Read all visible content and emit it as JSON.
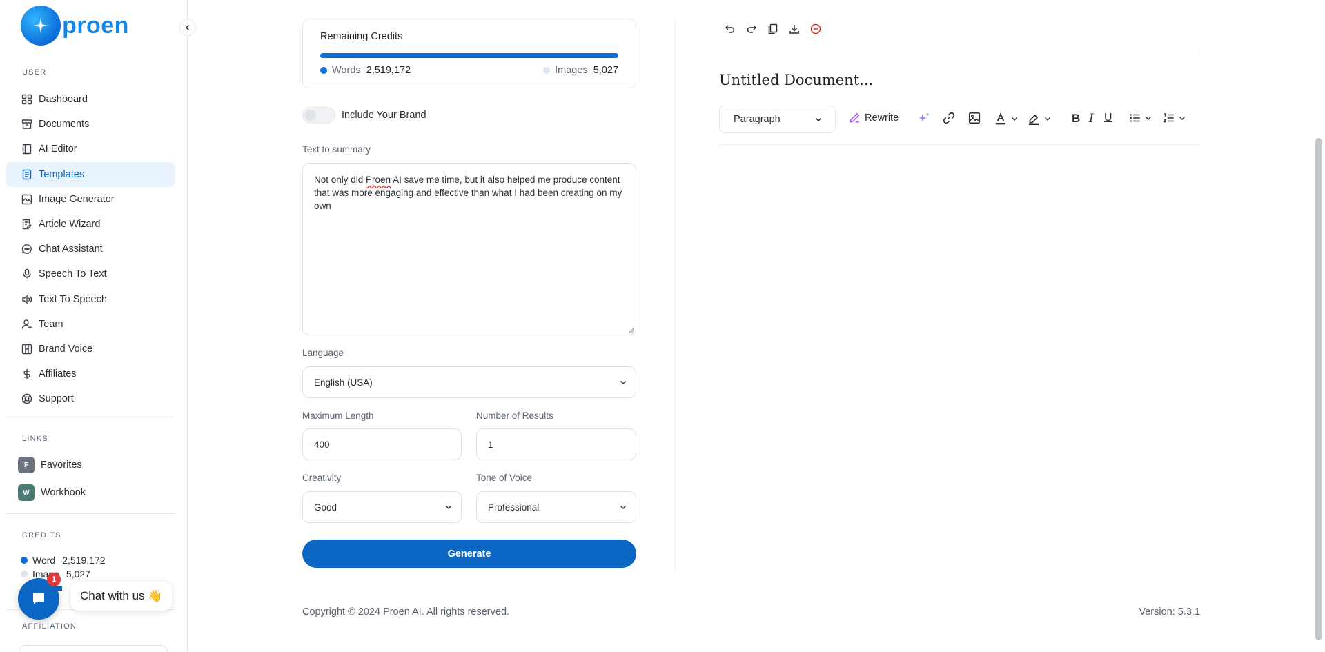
{
  "app": {
    "name": "proen"
  },
  "sidebar": {
    "user_label": "USER",
    "items": [
      {
        "label": "Dashboard",
        "icon": "grid-icon"
      },
      {
        "label": "Documents",
        "icon": "archive-icon"
      },
      {
        "label": "AI Editor",
        "icon": "book-icon"
      },
      {
        "label": "Templates",
        "icon": "file-text-icon",
        "active": true
      },
      {
        "label": "Image Generator",
        "icon": "image-icon"
      },
      {
        "label": "Article Wizard",
        "icon": "file-pen-icon"
      },
      {
        "label": "Chat Assistant",
        "icon": "message-circle-icon"
      },
      {
        "label": "Speech To Text",
        "icon": "microphone-icon"
      },
      {
        "label": "Text To Speech",
        "icon": "speaker-icon"
      },
      {
        "label": "Team",
        "icon": "user-plus-icon"
      },
      {
        "label": "Brand Voice",
        "icon": "layout-icon"
      },
      {
        "label": "Affiliates",
        "icon": "dollar-icon"
      },
      {
        "label": "Support",
        "icon": "lifebuoy-icon"
      }
    ],
    "links_label": "LINKS",
    "links": [
      {
        "badge": "F",
        "label": "Favorites",
        "color": "#6b7280"
      },
      {
        "badge": "W",
        "label": "Workbook",
        "color": "#4b7a74"
      }
    ],
    "credits_label": "CREDITS",
    "credits": {
      "word_label": "Word",
      "word_value": "2,519,172",
      "image_label": "Image",
      "image_value": "5,027"
    },
    "affiliation_label": "AFFILIATION"
  },
  "chat_widget": {
    "count": "1",
    "text": "Chat with us 👋"
  },
  "form": {
    "remaining_credits_title": "Remaining Credits",
    "words_label": "Words",
    "words_value": "2,519,172",
    "images_label": "Images",
    "images_value": "5,027",
    "include_brand_label": "Include Your Brand",
    "text_label": "Text to summary",
    "text_value_before": "Not only did ",
    "text_value_spell": "Proen",
    "text_value_after": " AI save me time, but it also helped me produce content that was more engaging and effective than what I had been creating on my own",
    "language_label": "Language",
    "language_value": "English (USA)",
    "max_length_label": "Maximum Length",
    "max_length_value": "400",
    "results_label": "Number of Results",
    "results_value": "1",
    "creativity_label": "Creativity",
    "creativity_value": "Good",
    "tone_label": "Tone of Voice",
    "tone_value": "Professional",
    "generate_label": "Generate"
  },
  "editor": {
    "title": "Untitled Document...",
    "paragraph_label": "Paragraph",
    "rewrite_label": "Rewrite"
  },
  "footer": {
    "copyright": "Copyright © 2024 Proen AI. All rights reserved.",
    "version": "Version: 5.3.1"
  },
  "colors": {
    "accent": "#0b66c3",
    "active_bg": "#e8f3fd",
    "bar": "#0b6fd6",
    "badge": "#e23a3a"
  }
}
